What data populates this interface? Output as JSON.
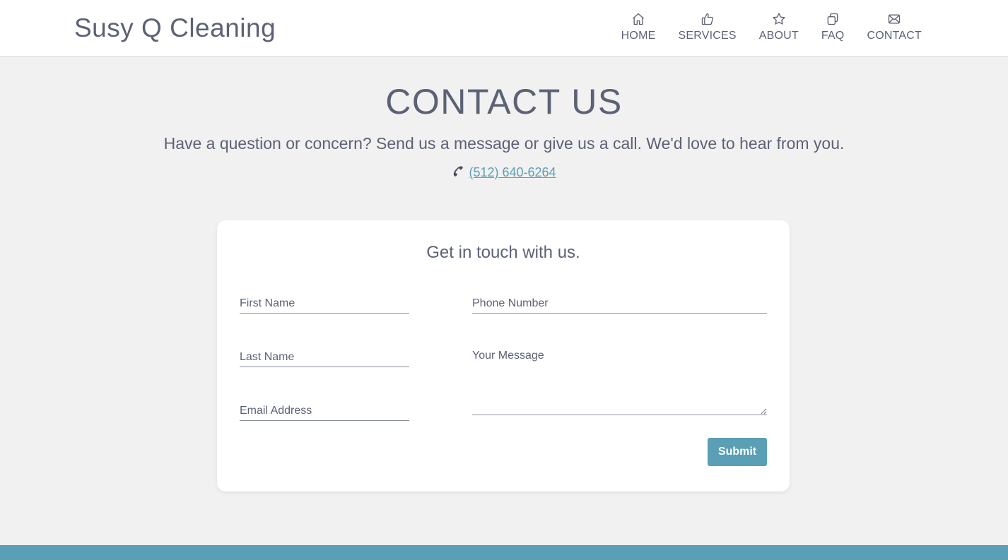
{
  "header": {
    "brand": "Susy Q Cleaning",
    "nav": [
      {
        "label": "HOME",
        "icon": "home-icon"
      },
      {
        "label": "SERVICES",
        "icon": "thumbs-up-icon"
      },
      {
        "label": "ABOUT",
        "icon": "star-icon"
      },
      {
        "label": "FAQ",
        "icon": "copy-icon"
      },
      {
        "label": "CONTACT",
        "icon": "envelope-icon"
      }
    ]
  },
  "hero": {
    "title": "CONTACT US",
    "subtitle": "Have a question or concern? Send us a message or give us a call. We'd love to hear from you.",
    "phone": "(512) 640-6264",
    "phone_icon": "phone-icon"
  },
  "form": {
    "title": "Get in touch with us.",
    "first_name_placeholder": "First Name",
    "last_name_placeholder": "Last Name",
    "email_placeholder": "Email Address",
    "phone_placeholder": "Phone Number",
    "message_placeholder": "Your Message",
    "submit_label": "Submit"
  },
  "colors": {
    "accent": "#5a9fb5",
    "text": "#5c6275",
    "background": "#f1f1f1"
  }
}
